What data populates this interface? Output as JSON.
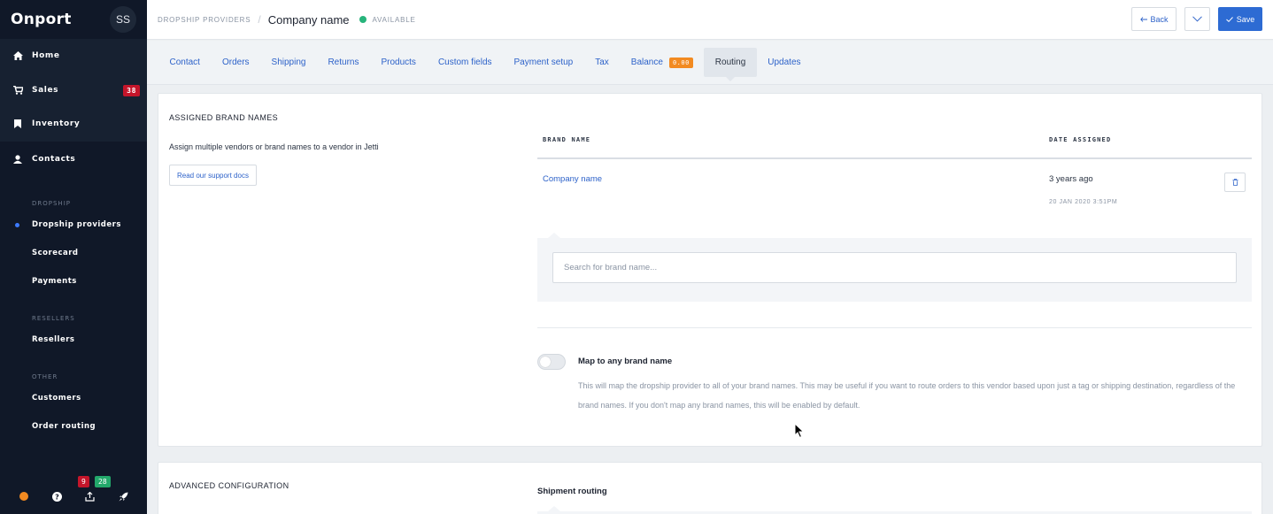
{
  "sidebar": {
    "logo": "Onport",
    "avatar": "SS",
    "nav": [
      {
        "label": "Home",
        "icon": "home-icon"
      },
      {
        "label": "Sales",
        "icon": "cart-icon",
        "count": "38"
      },
      {
        "label": "Inventory",
        "icon": "bookmark-icon"
      },
      {
        "label": "Contacts",
        "icon": "user-icon"
      }
    ],
    "sections": {
      "dropship": "DROPSHIP",
      "resellers": "RESELLERS",
      "other": "OTHER"
    },
    "dropship_items": [
      "Dropship providers",
      "Scorecard",
      "Payments"
    ],
    "reseller_items": [
      "Resellers"
    ],
    "other_items": [
      "Customers",
      "Order routing"
    ],
    "bottom": {
      "badge_red": "9",
      "badge_green": "28"
    }
  },
  "header": {
    "breadcrumb": "DROPSHIP PROVIDERS",
    "separator": "/",
    "title": "Company name",
    "status": "AVAILABLE",
    "back_label": "Back",
    "save_label": "Save"
  },
  "tabs": {
    "items": [
      "Contact",
      "Orders",
      "Shipping",
      "Returns",
      "Products",
      "Custom fields",
      "Payment setup",
      "Tax",
      "Balance",
      "Routing",
      "Updates"
    ],
    "balance_badge": "0.00",
    "active": "Routing"
  },
  "brand_card": {
    "title": "ASSIGNED BRAND NAMES",
    "description": "Assign multiple vendors or brand names to a vendor in Jetti",
    "docs_button": "Read our support docs",
    "columns": [
      "BRAND NAME",
      "DATE ASSIGNED"
    ],
    "rows": [
      {
        "brand": "Company name",
        "ago": "3 years ago",
        "date": "20 JAN 2020 3:51PM"
      }
    ],
    "search_placeholder": "Search for brand name...",
    "toggle_label": "Map to any brand name",
    "toggle_description": "This will map the dropship provider to all of your brand names. This may be useful if you want to route orders to this vendor based upon just a tag or shipping destination, regardless of the brand names. If you don't map any brand names, this will be enabled by default."
  },
  "advanced_card": {
    "title": "ADVANCED CONFIGURATION",
    "shipment_routing": "Shipment routing"
  },
  "colors": {
    "sidebar_bg": "#101828",
    "accent": "#2d6bd3",
    "link": "#2d62c9",
    "status_green": "#27b47b",
    "badge_red": "#c4152a",
    "badge_orange": "#f28a21"
  }
}
